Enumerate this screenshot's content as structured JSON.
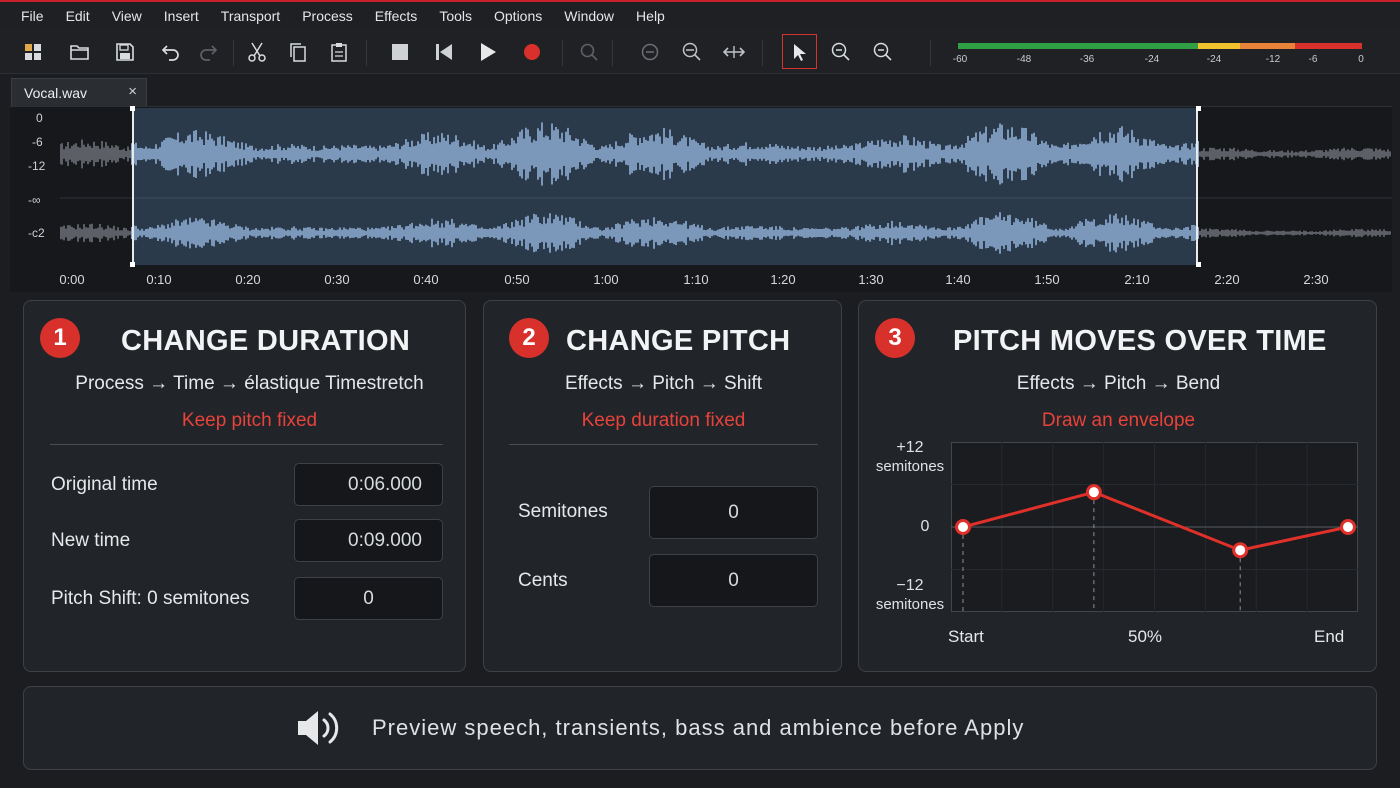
{
  "menu": [
    "File",
    "Edit",
    "View",
    "Insert",
    "Transport",
    "Process",
    "Effects",
    "Tools",
    "Options",
    "Window",
    "Help"
  ],
  "toolbar": {
    "icons": [
      "app-grid-icon",
      "open-folder-icon",
      "save-icon",
      "undo-icon",
      "redo-icon",
      "cut-icon",
      "copy-icon",
      "paste-icon",
      "stop-icon",
      "skip-back-icon",
      "play-icon",
      "record-icon",
      "search-icon",
      "zoom-reset-icon",
      "zoom-fit-icon",
      "zoom-fit-width-icon",
      "select-arrow-icon",
      "zoom-in-icon",
      "zoom-out-icon"
    ],
    "record_color": "#d8312c"
  },
  "meter": {
    "labels": [
      "-60",
      "-48",
      "-36",
      "-24",
      "-24",
      "-12",
      "-6",
      "0"
    ],
    "colors": [
      "#2f9e44",
      "#f2c12e",
      "#e8843a",
      "#d8312c"
    ]
  },
  "tab": {
    "label": "Vocal.wav",
    "close": "×"
  },
  "waveform": {
    "db_labels": [
      "0",
      "-6",
      "-12",
      "-∞",
      "-c2"
    ],
    "time_labels": [
      "0:00",
      "0:10",
      "0:20",
      "0:30",
      "0:40",
      "0:50",
      "1:00",
      "1:10",
      "1:20",
      "1:30",
      "1:40",
      "1:50",
      "2:10",
      "2:20",
      "2:30"
    ],
    "wave_color": "#a9c6ea",
    "selection_color": "#5a82af"
  },
  "panels": {
    "duration": {
      "number": "1",
      "title": "CHANGE DURATION",
      "path": "Process → Time → élastique Timestretch",
      "note": "Keep pitch fixed",
      "fields": [
        {
          "label": "Original time",
          "value": "0:06.000"
        },
        {
          "label": "New time",
          "value": "0:09.000"
        },
        {
          "label": "Pitch Shift: 0 semitones",
          "value": "0"
        }
      ]
    },
    "pitch": {
      "number": "2",
      "title": "CHANGE PITCH",
      "path": "Effects → Pitch → Shift",
      "note": "Keep duration fixed",
      "fields": [
        {
          "label": "Semitones",
          "value": "0"
        },
        {
          "label": "Cents",
          "value": "0"
        }
      ]
    },
    "bend": {
      "number": "3",
      "title": "PITCH MOVES OVER TIME",
      "path": "Effects → Pitch → Bend",
      "note": "Draw an envelope",
      "y_top": "+12",
      "y_top_unit": "semitones",
      "y_mid": "0",
      "y_bottom": "−12",
      "y_bottom_unit": "semitones",
      "x_start": "Start",
      "x_mid": "50%",
      "x_end": "End",
      "envelope": [
        {
          "pos": 0.0,
          "semitones": 0
        },
        {
          "pos": 0.34,
          "semitones": 6
        },
        {
          "pos": 0.72,
          "semitones": -4
        },
        {
          "pos": 1.0,
          "semitones": 0
        }
      ],
      "line_color": "#e0302a"
    }
  },
  "preview": {
    "icon": "speaker-icon",
    "text": "Preview speech, transients, bass and ambience before Apply"
  }
}
